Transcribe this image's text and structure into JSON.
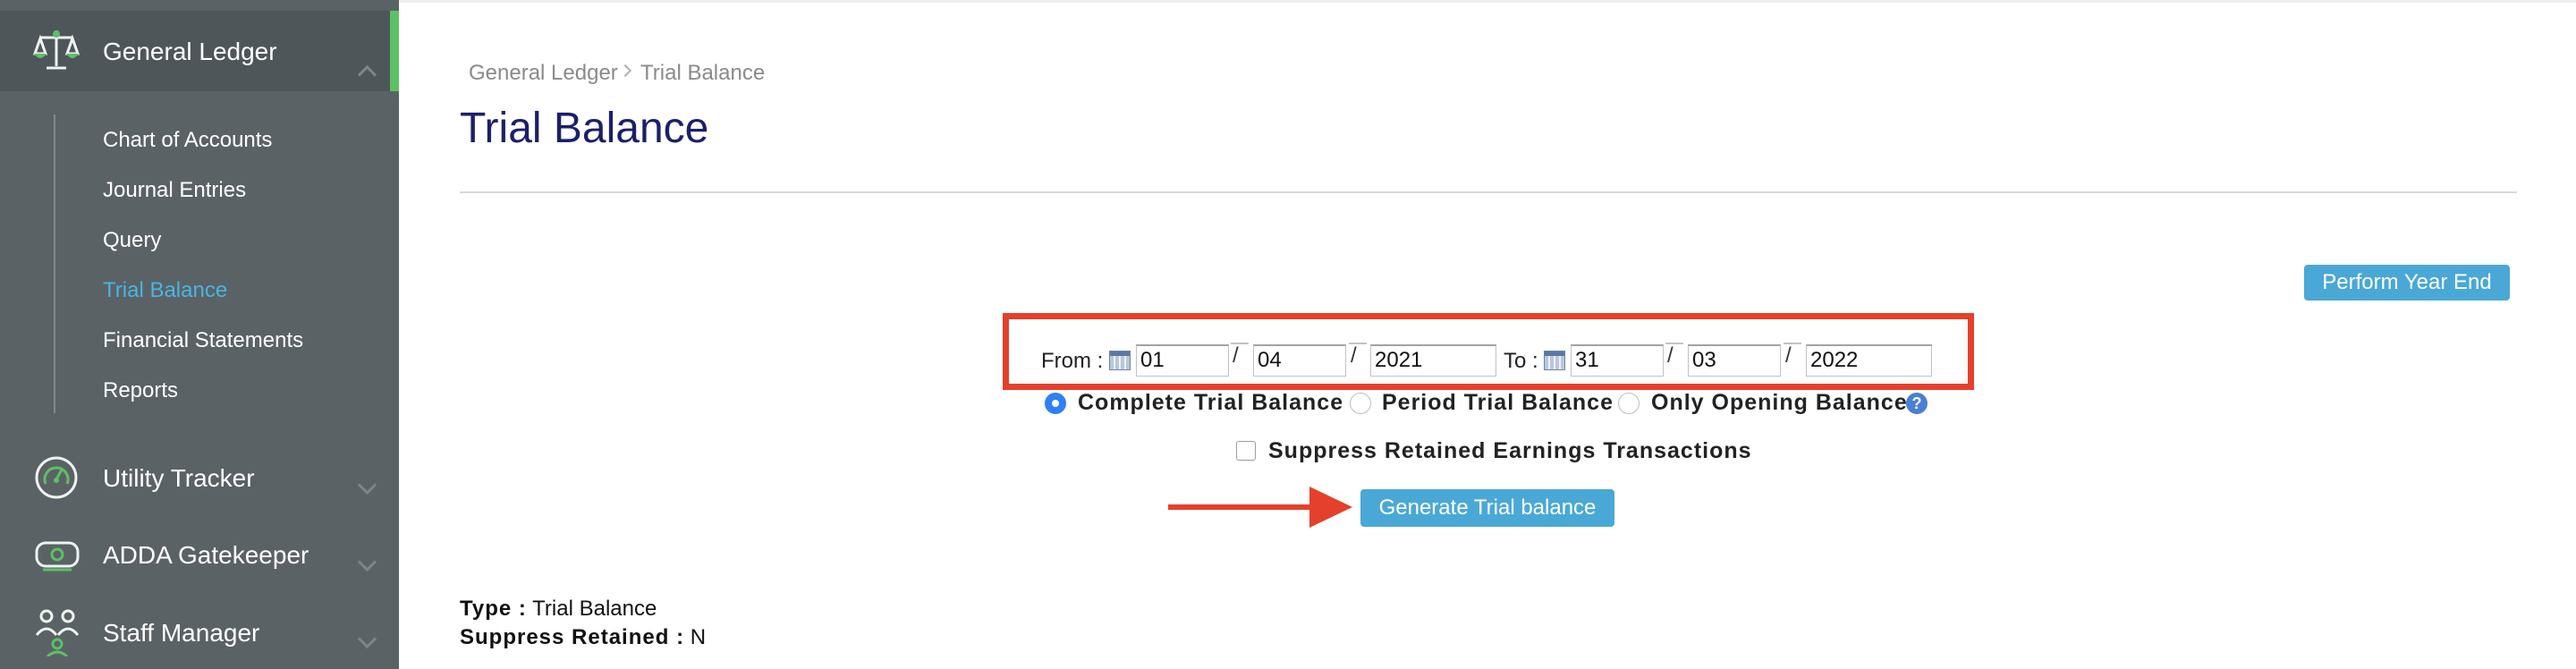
{
  "sidebar": {
    "sections": [
      {
        "title": "General Ledger",
        "icon": "scales-icon",
        "expanded": true
      },
      {
        "title": "Utility Tracker",
        "icon": "gauge-icon",
        "expanded": false
      },
      {
        "title": "ADDA Gatekeeper",
        "icon": "gatekeeper-icon",
        "expanded": false
      },
      {
        "title": "Staff Manager",
        "icon": "staff-icon",
        "expanded": false
      }
    ],
    "sub_items": [
      {
        "label": "Chart of Accounts",
        "active": false
      },
      {
        "label": "Journal Entries",
        "active": false
      },
      {
        "label": "Query",
        "active": false
      },
      {
        "label": "Trial Balance",
        "active": true
      },
      {
        "label": "Financial Statements",
        "active": false
      },
      {
        "label": "Reports",
        "active": false
      }
    ],
    "accent_color": "#5cc065",
    "active_color": "#49b5e2"
  },
  "breadcrumb": {
    "items": [
      "General Ledger",
      "Trial Balance"
    ]
  },
  "page": {
    "title": "Trial Balance"
  },
  "actions": {
    "perform_year_end": "Perform Year End",
    "generate": "Generate Trial balance"
  },
  "date_range": {
    "from_label": "From :",
    "to_label": "To :",
    "from": {
      "day": "01",
      "month": "04",
      "year": "2021"
    },
    "to": {
      "day": "31",
      "month": "03",
      "year": "2022"
    },
    "separator": "/"
  },
  "options": {
    "radios": [
      {
        "label": "Complete Trial Balance",
        "selected": true
      },
      {
        "label": "Period Trial Balance",
        "selected": false
      },
      {
        "label": "Only Opening Balance",
        "selected": false
      }
    ],
    "help": "?",
    "suppress_checkbox": {
      "label": "Suppress Retained Earnings Transactions",
      "checked": false
    }
  },
  "summary": {
    "type_label": "Type :",
    "type_value": "Trial Balance",
    "suppress_label": "Suppress Retained :",
    "suppress_value": "N"
  },
  "colors": {
    "title": "#1b1f6b",
    "button": "#4aa8d6",
    "annotation": "#e5402b"
  }
}
